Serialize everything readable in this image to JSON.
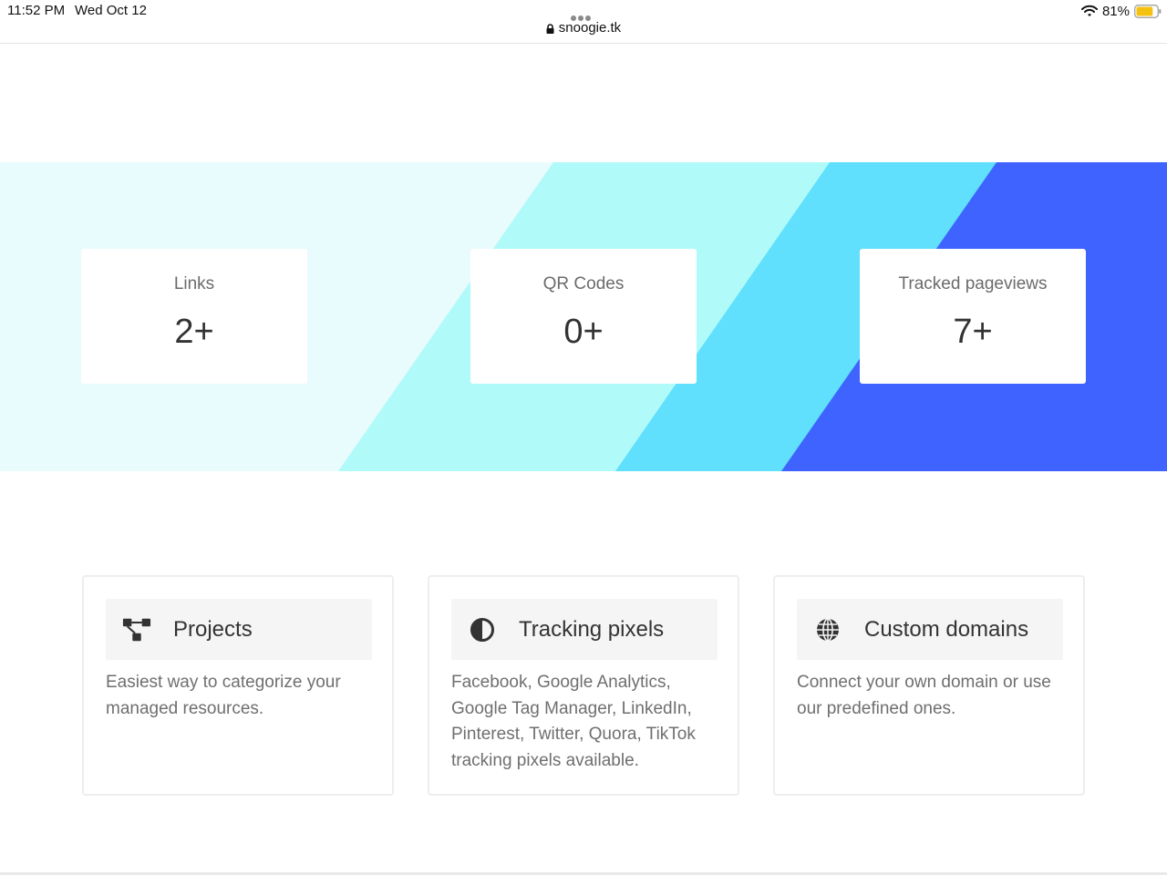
{
  "status_bar": {
    "time": "11:52 PM",
    "date": "Wed Oct 12",
    "url": "snoogie.tk",
    "battery_percent": "81%",
    "battery_level": 0.81,
    "icons": [
      "lock-icon",
      "wifi-icon",
      "battery-icon",
      "more-dots-icon"
    ]
  },
  "hero": {
    "colors": [
      "#e8fbfd",
      "#b0fafa",
      "#60e0fd",
      "#3e63ff"
    ],
    "stats": [
      {
        "label": "Links",
        "value": "2+"
      },
      {
        "label": "QR Codes",
        "value": "0+"
      },
      {
        "label": "Tracked pageviews",
        "value": "7+"
      }
    ]
  },
  "features": [
    {
      "icon": "project-diagram-icon",
      "title": "Projects",
      "description": "Easiest way to categorize your managed resources."
    },
    {
      "icon": "adjust-half-circle-icon",
      "title": "Tracking pixels",
      "description": "Facebook, Google Analytics, Google Tag Manager, LinkedIn, Pinterest, Twitter, Quora, TikTok tracking pixels available."
    },
    {
      "icon": "globe-icon",
      "title": "Custom domains",
      "description": "Connect your own domain or use our predefined ones."
    }
  ]
}
